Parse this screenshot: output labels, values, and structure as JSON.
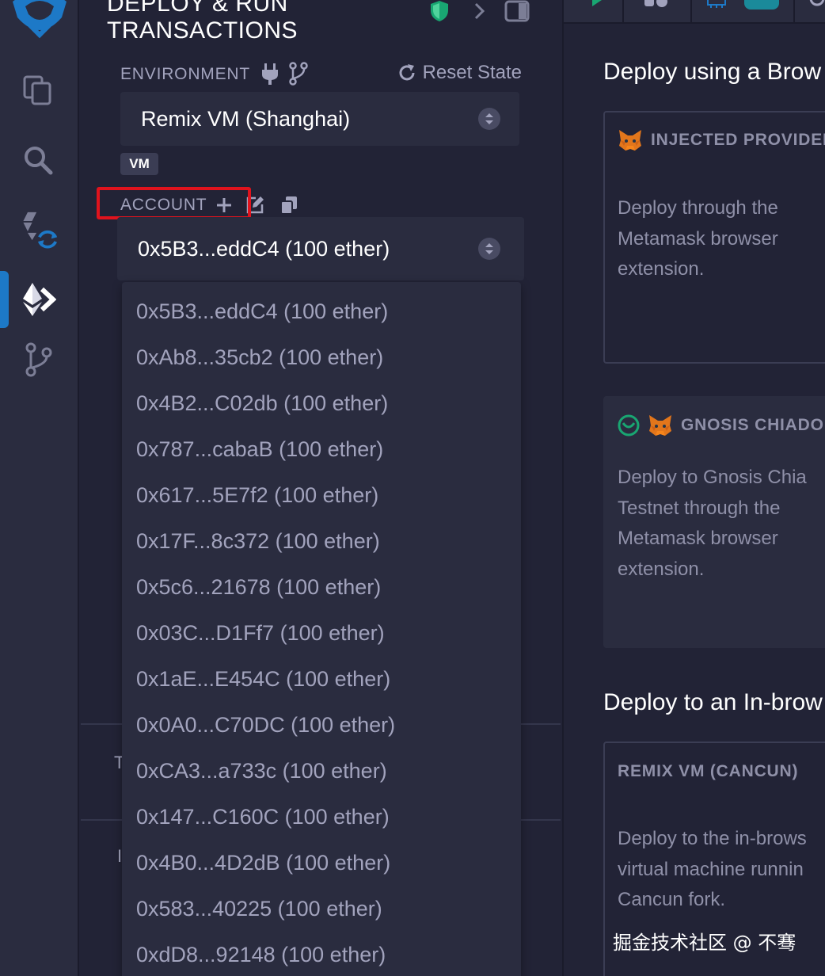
{
  "panel": {
    "title_line1": "DEPLOY & RUN",
    "title_line2": "TRANSACTIONS",
    "environment_label": "ENVIRONMENT",
    "reset_state_label": "Reset State",
    "environment_value": "Remix VM (Shanghai)",
    "vm_badge": "VM",
    "account_label": "ACCOUNT",
    "selected_account": "0x5B3...eddC4 (100 ether)",
    "accounts": [
      "0x5B3...eddC4 (100 ether)",
      "0xAb8...35cb2 (100 ether)",
      "0x4B2...C02db (100 ether)",
      "0x787...cabaB (100 ether)",
      "0x617...5E7f2 (100 ether)",
      "0x17F...8c372 (100 ether)",
      "0x5c6...21678 (100 ether)",
      "0x03C...D1Ff7 (100 ether)",
      "0x1aE...E454C (100 ether)",
      "0x0A0...C70DC (100 ether)",
      "0xCA3...a733c (100 ether)",
      "0x147...C160C (100 ether)",
      "0x4B0...4D2dB (100 ether)",
      "0x583...40225 (100 ether)",
      "0xdD8...92148 (100 ether)"
    ],
    "hidden_fragment_1": "T",
    "hidden_fragment_2": "I"
  },
  "main": {
    "section1_title": "Deploy using a Brow",
    "card1_title": "INJECTED PROVIDER",
    "card1_desc": "Deploy through the Metamask browser extension.",
    "card2_title": "GNOSIS CHIADO",
    "card2_desc": "Deploy to Gnosis Chia Testnet through the Metamask browser extension.",
    "section2_title": "Deploy to an In-brow",
    "card3_title": "REMIX VM (CANCUN)",
    "card3_desc": "Deploy to the in-brows virtual machine runnin Cancun fork."
  },
  "watermark": "掘金技术社区 @ 不骞",
  "icons": {
    "sidebar": [
      "remix-logo-icon",
      "file-explorer-icon",
      "search-icon",
      "solidity-compiler-icon",
      "deploy-run-icon",
      "git-icon"
    ],
    "header": [
      "shield-icon",
      "chevron-right-icon",
      "panel-toggle-icon"
    ],
    "env": [
      "plug-icon",
      "fork-icon",
      "refresh-icon"
    ],
    "account": [
      "plus-icon",
      "edit-icon",
      "copy-icon"
    ]
  },
  "colors": {
    "background": "#222336",
    "panel": "#2a2c3f",
    "active_marker": "#1d79c7",
    "highlight": "#e0131d",
    "shield": "#19a672"
  }
}
